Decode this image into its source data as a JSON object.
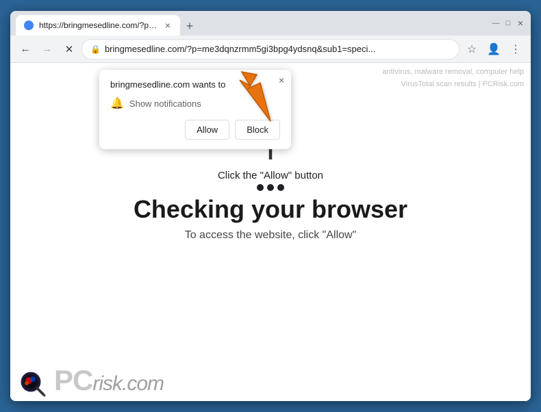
{
  "window": {
    "title_bar_bg": "#dee1e6"
  },
  "tab": {
    "url_short": "https://bringmesedline.com/?p=...",
    "close_label": "×",
    "new_tab_label": "+"
  },
  "window_controls": {
    "minimize": "—",
    "maximize": "□",
    "close": "✕"
  },
  "address_bar": {
    "back_icon": "←",
    "forward_icon": "→",
    "close_icon": "✕",
    "lock_icon": "🔒",
    "url": "bringmesedline.com/?p=me3dqnzrmm5gi3bpg4ydsnq&sub1=speci...",
    "star_icon": "☆",
    "profile_icon": "👤",
    "menu_icon": "⋮"
  },
  "notification_popup": {
    "site": "bringmesedline.com wants to",
    "close_btn": "×",
    "notification_label": "Show notifications",
    "allow_btn": "Allow",
    "block_btn": "Block"
  },
  "page": {
    "click_instruction": "Click the \"Allow\" button",
    "dots_count": 3,
    "main_heading": "Checking your browser",
    "sub_text": "To access the website, click \"Allow\""
  },
  "pcrisk": {
    "pc_text": "PC",
    "risk_text": "risk.com"
  },
  "bg_hints": {
    "line1": "antivirus, malware removal, computer help",
    "line2": "VirusTotal scan results | PCRisk.com"
  }
}
